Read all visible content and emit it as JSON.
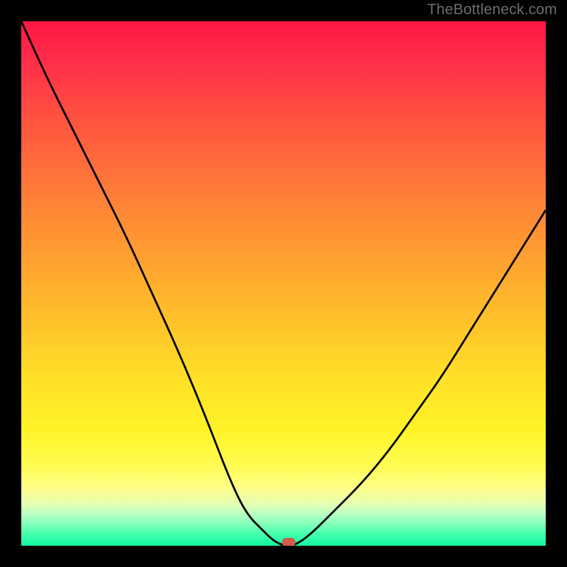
{
  "watermark": "TheBottleneck.com",
  "colors": {
    "frame_bg": "#000000",
    "gradient_top": "#ff1744",
    "gradient_bottom": "#11f7a0",
    "curve": "#000000",
    "marker_fill": "#d85a4a",
    "marker_stroke": "#b84434"
  },
  "chart_data": {
    "type": "line",
    "title": "",
    "xlabel": "",
    "ylabel": "",
    "xlim": [
      0,
      100
    ],
    "ylim": [
      0,
      100
    ],
    "series": [
      {
        "name": "curve",
        "x": [
          0,
          5,
          10,
          15,
          20,
          25,
          30,
          35,
          40,
          43,
          46,
          48,
          50,
          52,
          55,
          60,
          65,
          70,
          75,
          80,
          85,
          90,
          95,
          100
        ],
        "values": [
          100,
          89,
          79,
          69,
          59,
          48,
          37,
          25,
          12,
          6,
          3,
          1,
          0,
          0,
          2,
          7,
          12,
          18,
          25,
          32,
          40,
          48,
          56,
          64
        ]
      }
    ],
    "marker": {
      "x": 51,
      "y": 0.5,
      "name": "minimum-marker"
    },
    "flat_segment_x": [
      47,
      53
    ]
  }
}
